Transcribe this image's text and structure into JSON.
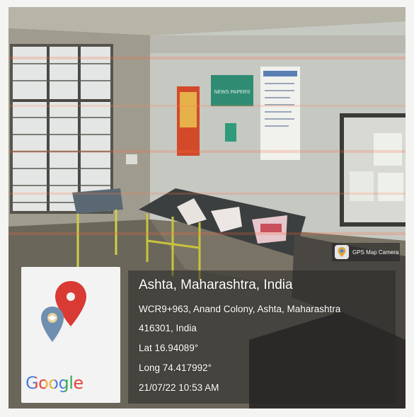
{
  "overlay": {
    "badge_label": "GPS Map Camera",
    "location_title": "Ashta, Maharashtra, India",
    "address_line1": "WCR9+963, Anand Colony, Ashta, Maharashtra",
    "address_line2": "416301, India",
    "latitude": "Lat 16.94089°",
    "longitude": "Long 74.417992°",
    "timestamp": "21/07/22 10:53 AM"
  },
  "map_card": {
    "brand": "Google",
    "icons": [
      "map-pin-red-icon",
      "map-pin-blue-icon"
    ]
  },
  "scene": {
    "poster_label": "NEWS PAPERS",
    "icons": [
      "window-icon",
      "notice-board-icon",
      "newspaper-stand-icon"
    ]
  },
  "colors": {
    "pin_red": "#d93a34",
    "pin_blue": "#6f8fb0",
    "pin_cream": "#e5d39a",
    "google_blue": "#4a7fe0",
    "google_red": "#e0463c",
    "google_yellow": "#e8b23a",
    "google_green": "#34a853",
    "overlay_bg": "#282828"
  }
}
